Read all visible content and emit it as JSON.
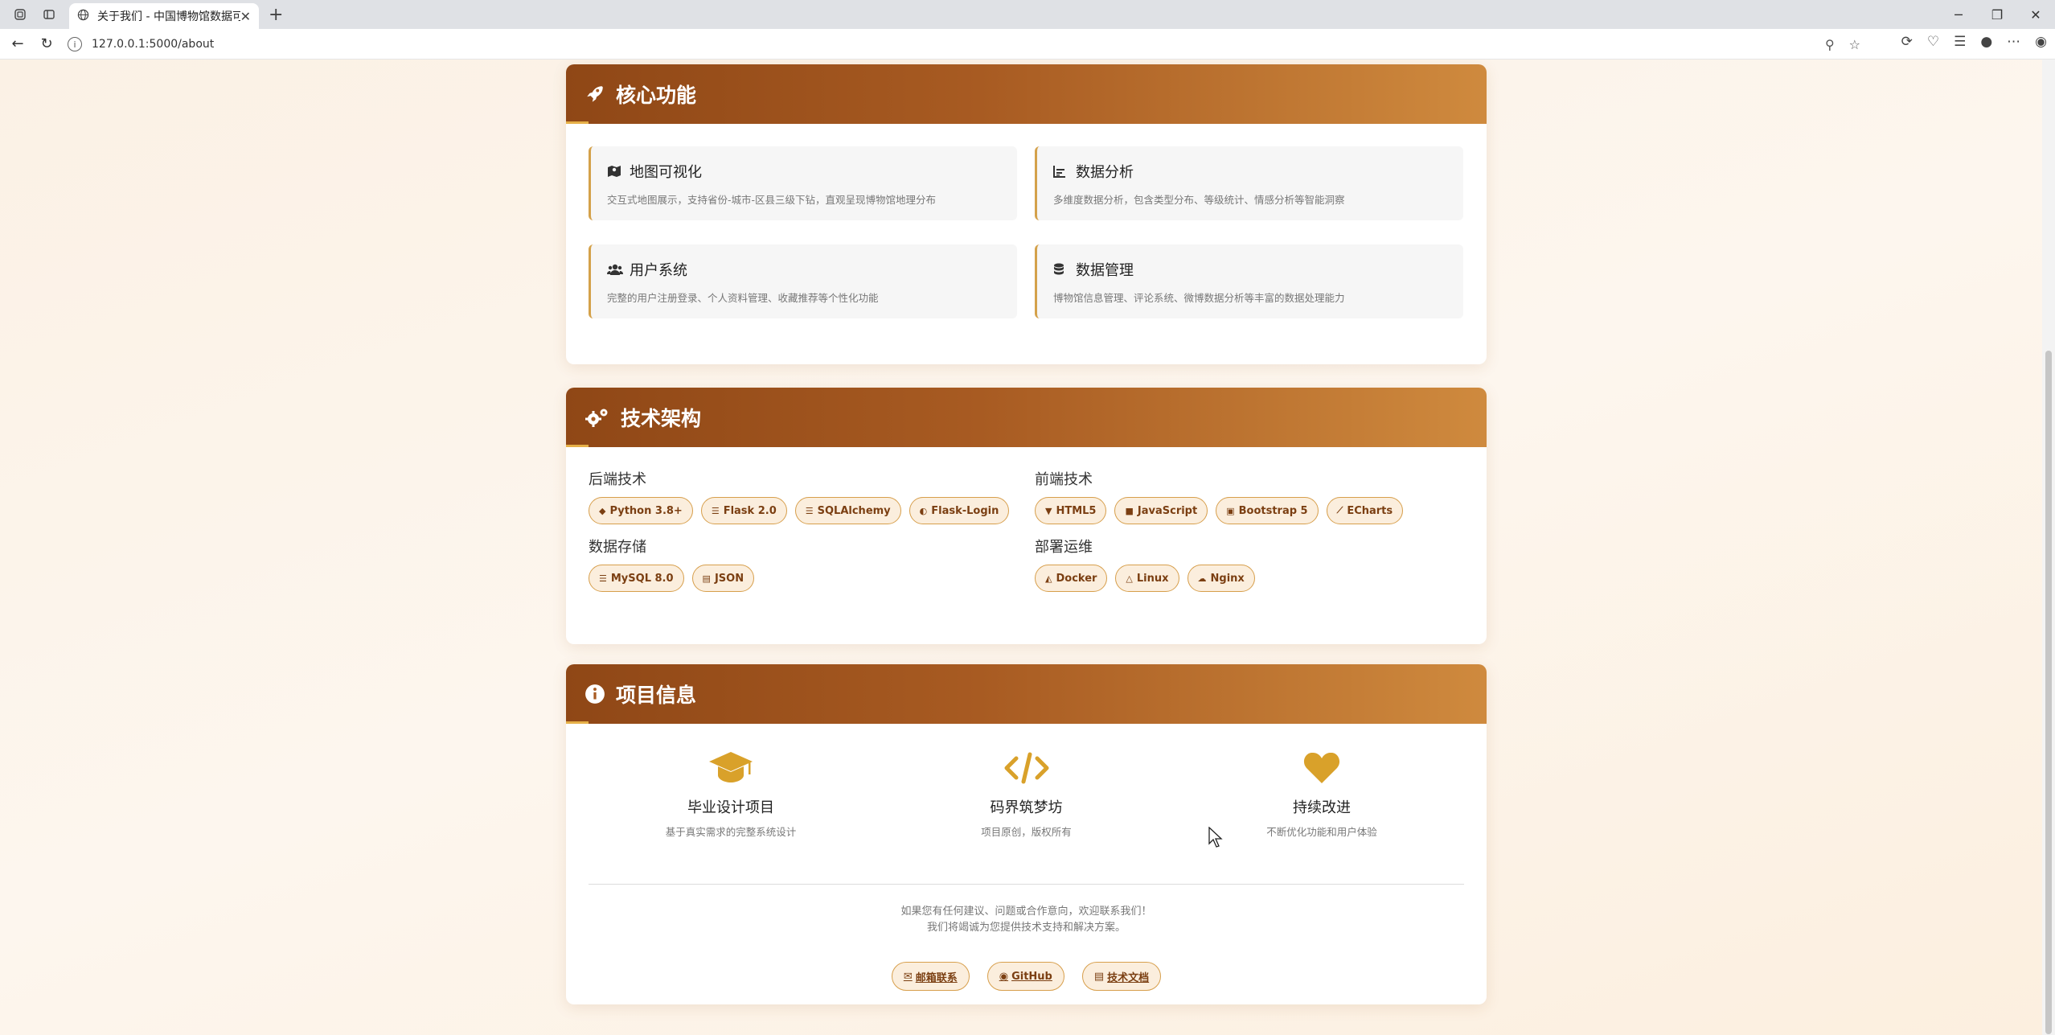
{
  "browser": {
    "tab_title": "关于我们 - 中国博物馆数据可视化",
    "url": "127.0.0.1:5000/about"
  },
  "features": {
    "title": "核心功能",
    "items": [
      {
        "icon": "map-icon",
        "title": "地图可视化",
        "desc": "交互式地图展示，支持省份-城市-区县三级下钻，直观呈现博物馆地理分布"
      },
      {
        "icon": "chart-bar-icon",
        "title": "数据分析",
        "desc": "多维度数据分析，包含类型分布、等级统计、情感分析等智能洞察"
      },
      {
        "icon": "users-icon",
        "title": "用户系统",
        "desc": "完整的用户注册登录、个人资料管理、收藏推荐等个性化功能"
      },
      {
        "icon": "database-icon",
        "title": "数据管理",
        "desc": "博物馆信息管理、评论系统、微博数据分析等丰富的数据处理能力"
      }
    ]
  },
  "tech": {
    "title": "技术架构",
    "groups": [
      {
        "label": "后端技术",
        "badges": [
          {
            "icon": "python-icon",
            "text": "Python 3.8+"
          },
          {
            "icon": "server-icon",
            "text": "Flask 2.0"
          },
          {
            "icon": "database-icon",
            "text": "SQLAlchemy"
          },
          {
            "icon": "shield-icon",
            "text": "Flask-Login"
          }
        ]
      },
      {
        "label": "前端技术",
        "badges": [
          {
            "icon": "html5-icon",
            "text": "HTML5"
          },
          {
            "icon": "js-icon",
            "text": "JavaScript"
          },
          {
            "icon": "bootstrap-icon",
            "text": "Bootstrap 5"
          },
          {
            "icon": "line-chart-icon",
            "text": "ECharts"
          }
        ]
      },
      {
        "label": "数据存储",
        "badges": [
          {
            "icon": "database-icon",
            "text": "MySQL 8.0"
          },
          {
            "icon": "file-icon",
            "text": "JSON"
          }
        ]
      },
      {
        "label": "部署运维",
        "badges": [
          {
            "icon": "docker-icon",
            "text": "Docker"
          },
          {
            "icon": "linux-icon",
            "text": "Linux"
          },
          {
            "icon": "cloud-icon",
            "text": "Nginx"
          }
        ]
      }
    ]
  },
  "project": {
    "title": "项目信息",
    "items": [
      {
        "icon": "graduation-cap-icon",
        "title": "毕业设计项目",
        "desc": "基于真实需求的完整系统设计"
      },
      {
        "icon": "code-icon",
        "title": "码界筑梦坊",
        "desc": "项目原创，版权所有"
      },
      {
        "icon": "heart-icon",
        "title": "持续改进",
        "desc": "不断优化功能和用户体验"
      }
    ],
    "contact_line1": "如果您有任何建议、问题或合作意向，欢迎联系我们！",
    "contact_line2": "我们将竭诚为您提供技术支持和解决方案。",
    "links": [
      {
        "icon": "envelope-icon",
        "text": "邮箱联系"
      },
      {
        "icon": "github-icon",
        "text": "GitHub"
      },
      {
        "icon": "file-icon",
        "text": "技术文档"
      }
    ]
  },
  "colors": {
    "header_start": "#8f4716",
    "header_end": "#cf8a3e",
    "accent": "#d4a14a",
    "icon_gold": "#d9a12a"
  }
}
